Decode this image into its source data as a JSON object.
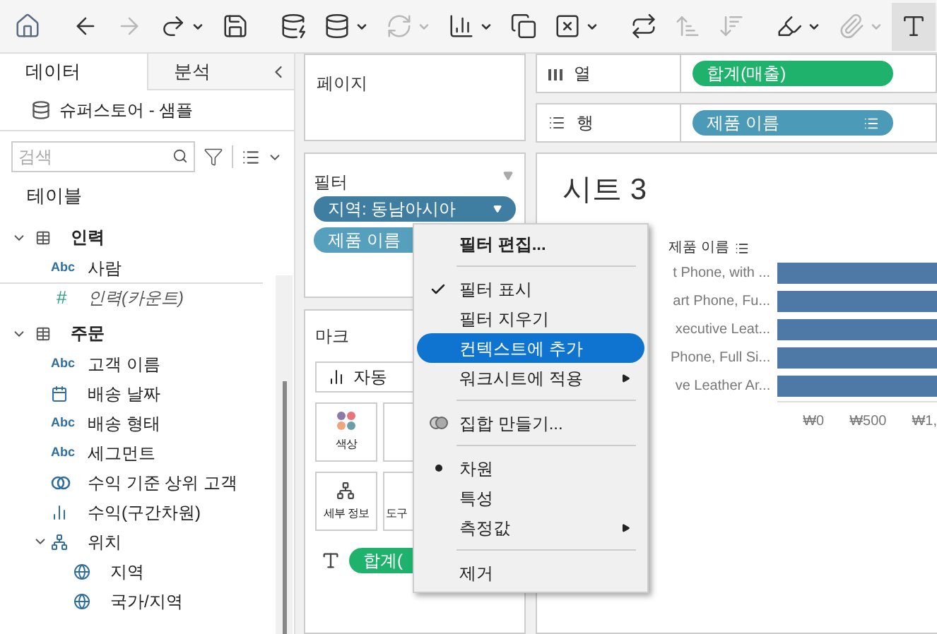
{
  "toolbar": [
    {
      "kind": "home",
      "disabled": false
    },
    {
      "kind": "back",
      "disabled": false
    },
    {
      "kind": "forward",
      "disabled": true
    },
    {
      "kind": "redo",
      "disabled": false,
      "dropdown": true
    },
    {
      "kind": "save",
      "disabled": false
    },
    {
      "kind": "new-datasource",
      "disabled": false
    },
    {
      "kind": "pause",
      "disabled": false,
      "dropdown": true
    },
    {
      "kind": "refresh",
      "disabled": true,
      "dropdown": true
    },
    {
      "kind": "new-sheet",
      "disabled": false,
      "dropdown": true
    },
    {
      "kind": "duplicate",
      "disabled": false
    },
    {
      "kind": "clear",
      "disabled": false,
      "dropdown": true
    },
    {
      "kind": "swap",
      "disabled": false
    },
    {
      "kind": "sort-asc",
      "disabled": true
    },
    {
      "kind": "sort-desc",
      "disabled": true
    },
    {
      "kind": "highlight",
      "disabled": false,
      "dropdown": true
    },
    {
      "kind": "attach",
      "disabled": true,
      "dropdown": true
    },
    {
      "kind": "labels",
      "disabled": false,
      "selected": true
    }
  ],
  "sidebar": {
    "tabs": [
      {
        "label": "데이터",
        "selected": true
      },
      {
        "label": "분석",
        "selected": false
      }
    ],
    "datasource": "슈퍼스토어 - 샘플",
    "search": {
      "placeholder": "검색"
    },
    "section": "테이블",
    "tables": [
      {
        "name": "인력",
        "expanded": true,
        "children": [
          {
            "name": "사람",
            "kind": "string",
            "glyph": "Abc"
          },
          {
            "name": "인력(카운트)",
            "kind": "number",
            "glyph": "#"
          }
        ]
      },
      {
        "name": "주문",
        "expanded": true,
        "children": [
          {
            "name": "고객 이름",
            "kind": "string",
            "glyph": "Abc"
          },
          {
            "name": "배송 날짜",
            "kind": "date"
          },
          {
            "name": "배송 형태",
            "kind": "string",
            "glyph": "Abc"
          },
          {
            "name": "세그먼트",
            "kind": "string",
            "glyph": "Abc"
          },
          {
            "name": "수익 기준 상위 고객",
            "kind": "set"
          },
          {
            "name": "수익(구간차원)",
            "kind": "bin"
          },
          {
            "name": "위치",
            "kind": "hierarchy",
            "expanded": true,
            "children": [
              {
                "name": "지역",
                "kind": "geo"
              },
              {
                "name": "국가/지역",
                "kind": "geo"
              }
            ]
          }
        ]
      }
    ]
  },
  "pages": {
    "title": "페이지"
  },
  "filters": {
    "title": "필터",
    "pills": [
      {
        "label": "지역: 동남아시아",
        "selected": true
      },
      {
        "label": "제품 이름",
        "selected": false
      }
    ]
  },
  "marks": {
    "title": "마크",
    "type": "자동",
    "cards": [
      {
        "kind": "color",
        "label": "색상"
      },
      {
        "kind": "size"
      },
      {
        "kind": "detail",
        "label": "세부 정보"
      },
      {
        "kind": "tooltip",
        "label": "도구"
      }
    ],
    "pill": "합계("
  },
  "columns": {
    "label": "열",
    "pill": "합계(매출)"
  },
  "rows": {
    "label": "행",
    "pill": "제품 이름"
  },
  "sheet": {
    "title": "시트 3",
    "header": "제품 이름",
    "row_labels": [
      "t Phone, with ...",
      "art Phone, Fu...",
      "xecutive Leat...",
      "Phone, Full Si...",
      "ve Leather Ar..."
    ],
    "ticks": [
      "₩0",
      "₩500",
      "₩1,"
    ]
  },
  "menu": [
    {
      "kind": "item",
      "label": "필터 편집...",
      "bold": true
    },
    {
      "kind": "separator"
    },
    {
      "kind": "item",
      "label": "필터 표시",
      "checked": true
    },
    {
      "kind": "item",
      "label": "필터 지우기",
      "checked": false
    },
    {
      "kind": "item",
      "label": "컨텍스트에 추가",
      "selected": true
    },
    {
      "kind": "item",
      "label": "워크시트에 적용",
      "submenu": true
    },
    {
      "kind": "separator"
    },
    {
      "kind": "set-item",
      "label": "집합 만들기..."
    },
    {
      "kind": "separator"
    },
    {
      "kind": "item",
      "label": "차원",
      "radio": true
    },
    {
      "kind": "item",
      "label": "특성",
      "radio": false
    },
    {
      "kind": "item",
      "label": "측정값",
      "submenu": true
    },
    {
      "kind": "separator"
    },
    {
      "kind": "item",
      "label": "제거"
    }
  ]
}
